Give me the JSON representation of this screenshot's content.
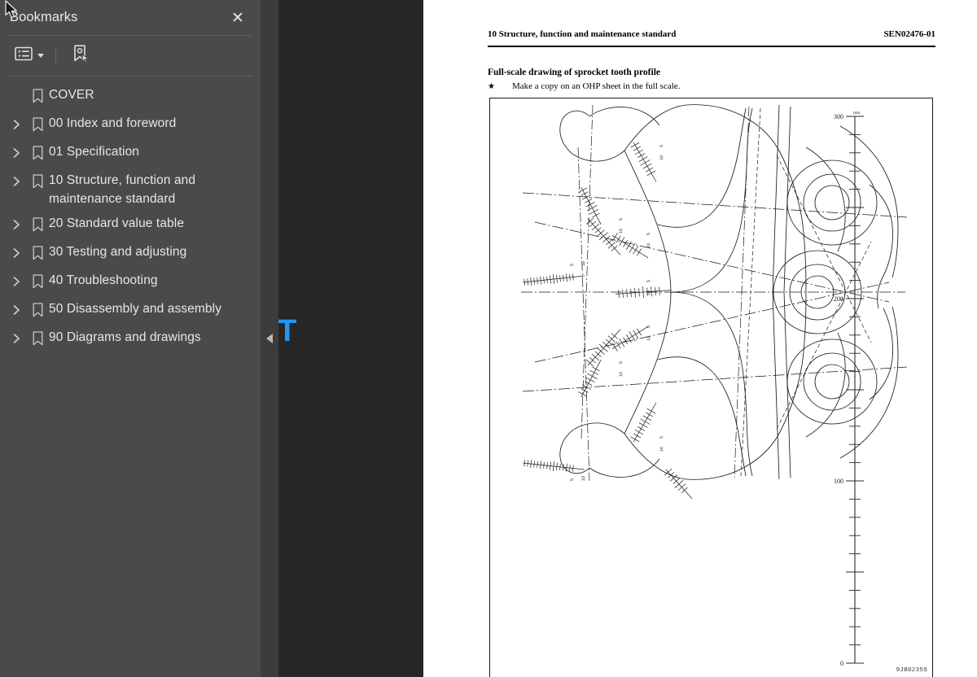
{
  "sidebar": {
    "title": "Bookmarks",
    "close_label": "✕",
    "toolbar": {
      "options_icon": "list-options-icon",
      "options_caret": "chevron-down-icon",
      "new_bookmark_icon": "new-bookmark-icon"
    },
    "items": [
      {
        "label": "COVER",
        "expandable": false
      },
      {
        "label": "00 Index and foreword",
        "expandable": true
      },
      {
        "label": "01 Specification",
        "expandable": true
      },
      {
        "label": "10 Structure, function and maintenance standard",
        "expandable": true
      },
      {
        "label": "20 Standard value table",
        "expandable": true
      },
      {
        "label": "30 Testing and adjusting",
        "expandable": true
      },
      {
        "label": "40 Troubleshooting",
        "expandable": true
      },
      {
        "label": "50 Disassembly and assembly",
        "expandable": true
      },
      {
        "label": "90 Diagrams and drawings",
        "expandable": true
      }
    ],
    "collapse_handle_icon": "collapse-panel-icon"
  },
  "document": {
    "header_left": "10 Structure, function and maintenance standard",
    "header_right": "SEN02476-01",
    "section_title": "Full-scale drawing of sprocket tooth profile",
    "note_marker": "★",
    "note_text": "Make a copy on an OHP sheet in the full scale.",
    "figure_code": "9JB02359",
    "scale": {
      "unit": "mm",
      "labels": [
        "300",
        "200",
        "100",
        "0"
      ],
      "max": 300,
      "min": 0,
      "major_step": 50,
      "minor_step": 10
    }
  },
  "watermark": {
    "text": "AUTOPDF.NET",
    "color": "#2196f3"
  },
  "colors": {
    "sidebar_bg": "#4a4a4a",
    "strip_bg": "#3c3c3c",
    "viewer_bg": "#262626",
    "page_bg": "#ffffff",
    "text": "#e7e7e7",
    "accent": "#2196f3"
  },
  "cursor": {
    "icon": "mouse-pointer-icon"
  }
}
